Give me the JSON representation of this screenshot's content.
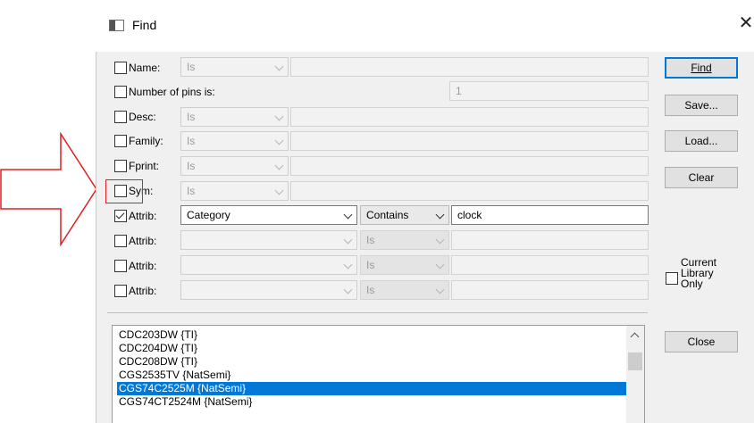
{
  "window": {
    "title": "Find",
    "close_glyph": "✕"
  },
  "criteria": {
    "name": {
      "label": "Name:",
      "operator": "Is",
      "value": ""
    },
    "pins": {
      "label": "Number of pins is:",
      "value": "1"
    },
    "desc": {
      "label": "Desc:",
      "operator": "Is",
      "value": ""
    },
    "family": {
      "label": "Family:",
      "operator": "Is",
      "value": ""
    },
    "fprint": {
      "label": "Fprint:",
      "operator": "Is",
      "value": ""
    },
    "sym": {
      "label": "Sym:",
      "operator": "Is",
      "value": ""
    },
    "attribs": [
      {
        "label": "Attrib:",
        "checked": true,
        "attribute": "Category",
        "operator": "Contains",
        "value": "clock"
      },
      {
        "label": "Attrib:",
        "checked": false,
        "attribute": "",
        "operator": "Is",
        "value": ""
      },
      {
        "label": "Attrib:",
        "checked": false,
        "attribute": "",
        "operator": "Is",
        "value": ""
      },
      {
        "label": "Attrib:",
        "checked": false,
        "attribute": "",
        "operator": "Is",
        "value": ""
      }
    ]
  },
  "buttons": {
    "find": "Find",
    "save": "Save...",
    "load": "Load...",
    "clear": "Clear",
    "close": "Close"
  },
  "current_library_only": {
    "label_line1": "Current",
    "label_line2": "Library",
    "label_line3": "Only",
    "checked": false
  },
  "results": [
    {
      "text": "CDC203DW {TI}",
      "selected": false
    },
    {
      "text": "CDC204DW {TI}",
      "selected": false
    },
    {
      "text": "CDC208DW {TI}",
      "selected": false
    },
    {
      "text": "CGS2535TV {NatSemi}",
      "selected": false
    },
    {
      "text": "CGS74C2525M {NatSemi}",
      "selected": true
    },
    {
      "text": "CGS74CT2524M {NatSemi}",
      "selected": false
    }
  ],
  "annotation": {
    "arrow_color": "#e02020",
    "highlight_target": "Sym"
  }
}
